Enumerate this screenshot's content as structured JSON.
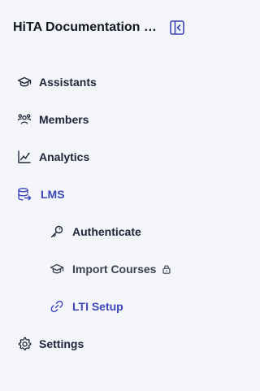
{
  "header": {
    "org_title": "HiTA Documentation O...",
    "collapse_icon": "sidebar-collapse-icon"
  },
  "nav": {
    "assistants": {
      "label": "Assistants",
      "icon": "graduation-cap-icon"
    },
    "members": {
      "label": "Members",
      "icon": "users-icon"
    },
    "analytics": {
      "label": "Analytics",
      "icon": "chart-icon"
    },
    "lms": {
      "label": "LMS",
      "icon": "database-arrow-icon",
      "active": true
    },
    "authenticate": {
      "label": "Authenticate",
      "icon": "key-icon"
    },
    "import_courses": {
      "label": "Import Courses",
      "icon": "graduation-cap-icon",
      "locked": true
    },
    "lti_setup": {
      "label": "LTI Setup",
      "icon": "link-icon",
      "active": true
    },
    "settings": {
      "label": "Settings",
      "icon": "gear-icon"
    }
  },
  "colors": {
    "background": "#f4f5f9",
    "accent": "#3c46b8",
    "text": "#20263a"
  }
}
